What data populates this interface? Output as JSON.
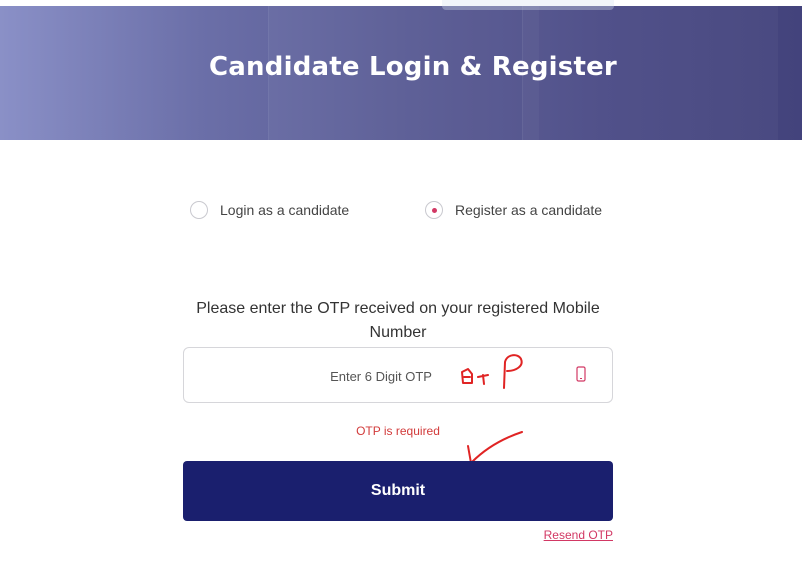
{
  "header": {
    "title": "Candidate Login & Register"
  },
  "auth_mode": {
    "options": [
      {
        "label": "Login as a candidate",
        "selected": false
      },
      {
        "label": "Register as a candidate",
        "selected": true
      }
    ]
  },
  "otp": {
    "instruction": "Please enter the OTP received on your registered Mobile Number",
    "placeholder": "Enter 6 Digit OTP",
    "value": "",
    "icon": "mobile-phone-icon",
    "error": "OTP is required"
  },
  "actions": {
    "submit_label": "Submit",
    "resend_label": "Resend OTP"
  },
  "colors": {
    "primary": "#1a1f6e",
    "accent": "#d23864",
    "error": "#d23a3a"
  }
}
